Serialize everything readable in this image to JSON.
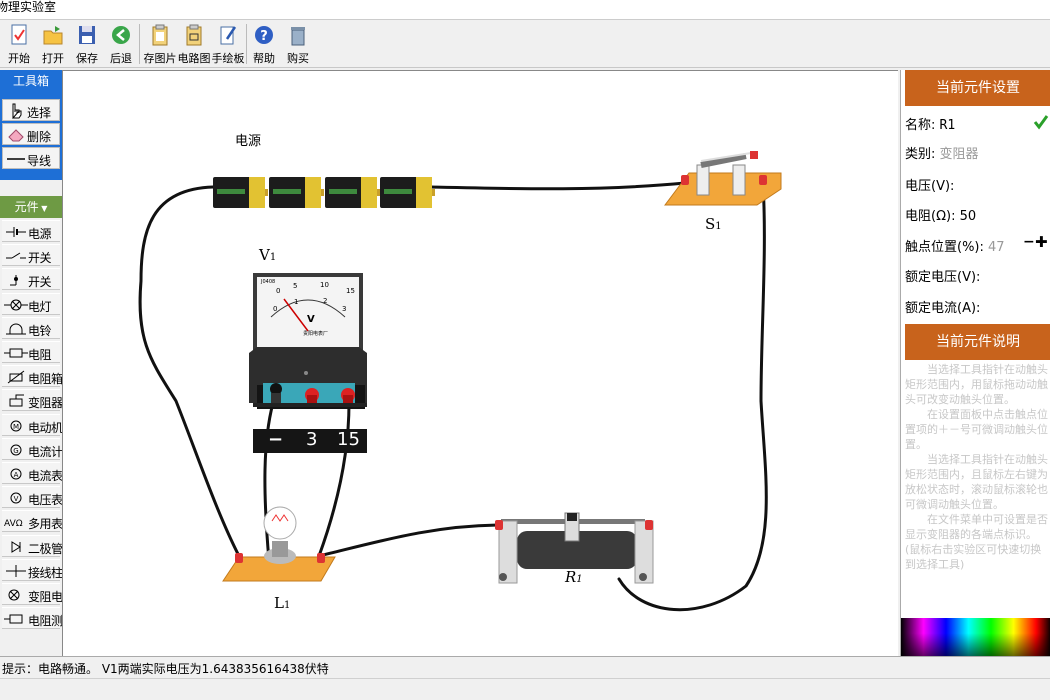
{
  "window": {
    "title": "物理实验室"
  },
  "toolbar": [
    {
      "label": "开始"
    },
    {
      "label": "打开"
    },
    {
      "label": "保存"
    },
    {
      "label": "后退"
    },
    {
      "label": "存图片"
    },
    {
      "label": "电路图"
    },
    {
      "label": "手绘板"
    },
    {
      "label": "帮助"
    },
    {
      "label": "购买"
    }
  ],
  "toolbox": {
    "title": "工具箱",
    "tools": [
      {
        "label": "选择"
      },
      {
        "label": "删除"
      },
      {
        "label": "导线"
      }
    ]
  },
  "components": {
    "title": "元件",
    "items": [
      {
        "label": "电源"
      },
      {
        "label": "开关"
      },
      {
        "label": "开关"
      },
      {
        "label": "电灯"
      },
      {
        "label": "电铃"
      },
      {
        "label": "电阻"
      },
      {
        "label": "电阻箱"
      },
      {
        "label": "变阻器"
      },
      {
        "label": "电动机"
      },
      {
        "label": "电流计"
      },
      {
        "label": "电流表"
      },
      {
        "label": "电压表"
      },
      {
        "label": "多用表"
      },
      {
        "label": "二极管"
      },
      {
        "label": "接线柱"
      },
      {
        "label": "变阻电灯"
      },
      {
        "label": "电阻测试"
      }
    ]
  },
  "circuit": {
    "power_label": "电源",
    "voltmeter": {
      "label": "V",
      "sub": "1",
      "scale_top": [
        "0",
        "5",
        "10",
        "15"
      ],
      "scale_bottom": [
        "0",
        "1",
        "2",
        "3"
      ],
      "unit": "V",
      "brand": "J0408",
      "maker": "贵阳电表厂",
      "terminals": [
        "−",
        "3",
        "15"
      ]
    },
    "switch": {
      "label": "S",
      "sub": "1"
    },
    "lamp": {
      "label": "L",
      "sub": "1"
    },
    "rheostat": {
      "label": "R",
      "sub": "1"
    }
  },
  "settings": {
    "title": "当前元件设置",
    "name_label": "名称:",
    "name_value": "R1",
    "type_label": "类别:",
    "type_value": "变阻器",
    "voltage_label": "电压(V):",
    "resistance_label": "电阻(Ω):",
    "resistance_value": "50",
    "contact_label": "触点位置(%):",
    "contact_value": "47",
    "rated_v_label": "额定电压(V):",
    "rated_i_label": "额定电流(A):"
  },
  "description": {
    "title": "当前元件说明",
    "paragraphs": [
      "当选择工具指针在动触头矩形范围内，用鼠标拖动动触头可改变动触头位置。",
      "在设置面板中点击触点位置项的＋－号可微调动触头位置。",
      "当选择工具指针在动触头矩形范围内，且鼠标左右键为放松状态时，滚动鼠标滚轮也可微调动触头位置。",
      "在文件菜单中可设置是否显示变阻器的各端点标识。",
      "(鼠标右击实验区可快速切换到选择工具)"
    ]
  },
  "status": {
    "text": "提示：电路畅通。   V1两端实际电压为1.643835616438伏特"
  },
  "colors": {
    "panel_header": "#c8631c",
    "toolbox_header": "#1e6fd6",
    "components_header": "#6e9a44"
  }
}
